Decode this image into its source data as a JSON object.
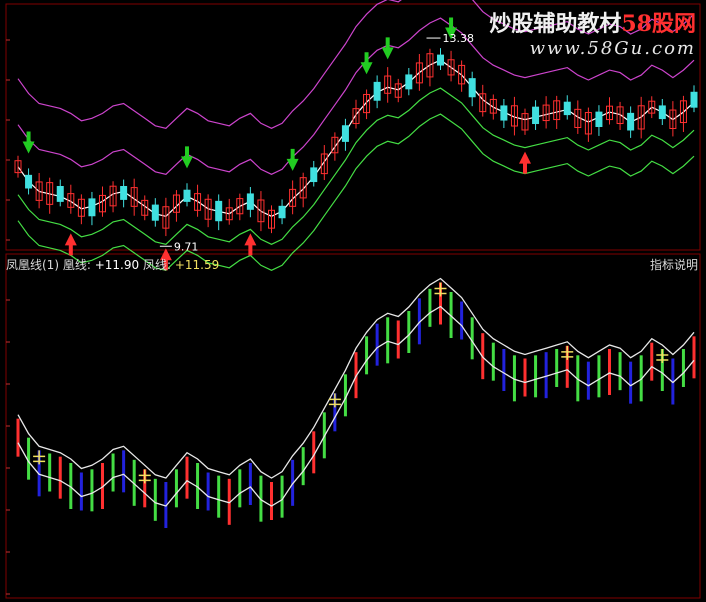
{
  "watermark": {
    "brand": "炒股辅助教材",
    "site": "58股网",
    "url": "www.58Gu.com"
  },
  "annotations": {
    "high": "13.38",
    "low": "9.71"
  },
  "legend": {
    "name": "凤凰线(1)",
    "huang_label": "凰线:",
    "huang_value": "+11.90",
    "feng_label": "凤线:",
    "feng_value": "+11.59"
  },
  "help_label": "指标说明",
  "colors": {
    "up": "#ff3030",
    "down": "#40e0e0",
    "mid": "#ffffff",
    "upper": "#cc44cc",
    "lower": "#44dd44",
    "band": "#e8e8e8",
    "buy": "#ff3030",
    "sell": "#22cc22",
    "bar_up": "#ff3030",
    "bar_green": "#44dd44",
    "bar_blue": "#2222dd",
    "marker": "#f0e060"
  },
  "chart_data": [
    {
      "type": "candlestick",
      "series": [
        {
          "name": "",
          "values": [
            11.0,
            10.7,
            10.5,
            10.45,
            10.4,
            10.3,
            10.15,
            10.2,
            10.3,
            10.45,
            10.5,
            10.35,
            10.2,
            10.05,
            10.0,
            10.2,
            10.4,
            10.3,
            10.15,
            10.1,
            10.05,
            10.2,
            10.3,
            10.1,
            10.0,
            10.1,
            10.35,
            10.55,
            10.8,
            11.1,
            11.4,
            11.7,
            12.05,
            12.3,
            12.5,
            12.6,
            12.55,
            12.7,
            12.9,
            13.05,
            13.15,
            13.0,
            12.85,
            12.6,
            12.35,
            12.2,
            12.1,
            12.0,
            11.95,
            12.0,
            12.05,
            12.1,
            12.15,
            12.0,
            11.9,
            12.0,
            12.1,
            12.05,
            11.9,
            12.0,
            12.2,
            12.1,
            11.95,
            12.1,
            12.3
          ]
        }
      ],
      "ylim": [
        9.4,
        14.2
      ],
      "annotations": [
        {
          "label": "13.38",
          "kind": "high"
        },
        {
          "label": "9.71",
          "kind": "low"
        }
      ]
    },
    {
      "type": "line",
      "title": "凤凰线(1)",
      "series": [
        {
          "name": "凰线",
          "last": 11.9
        },
        {
          "name": "凤线",
          "last": 11.59
        }
      ]
    }
  ]
}
